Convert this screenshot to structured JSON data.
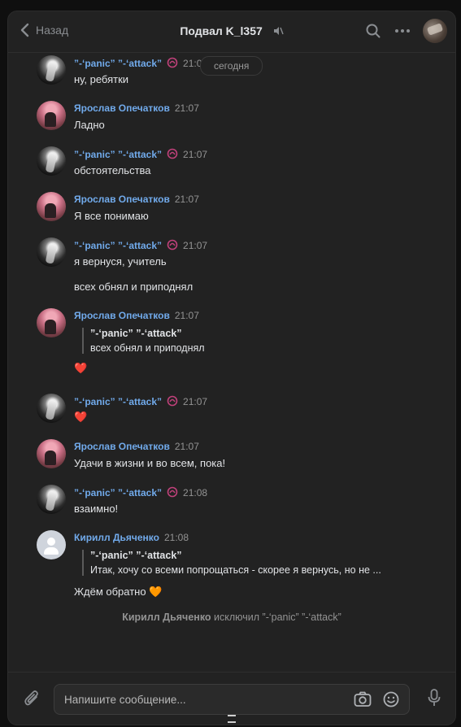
{
  "header": {
    "back_label": "Назад",
    "title": "Подвал K_l357"
  },
  "date_pill": "сегодня",
  "messages": [
    {
      "author": "”-‘panic” ”-‘attack”",
      "time": "21:07",
      "text": "ну, ребятки"
    },
    {
      "author": "Ярослав Опечатков",
      "time": "21:07",
      "text": "Ладно"
    },
    {
      "author": "”-‘panic” ”-‘attack”",
      "time": "21:07",
      "text": "обстоятельства"
    },
    {
      "author": "Ярослав Опечатков",
      "time": "21:07",
      "text": "Я все понимаю"
    },
    {
      "author": "”-‘panic” ”-‘attack”",
      "time": "21:07",
      "text": "я вернуся, учитель",
      "text2": "всех обнял и приподнял"
    },
    {
      "author": "Ярослав Опечатков",
      "time": "21:07",
      "quote_author": "”-‘panic” ”-‘attack”",
      "quote_text": "всех обнял и приподнял",
      "text": "❤️"
    },
    {
      "author": "”-‘panic” ”-‘attack”",
      "time": "21:07",
      "text": "❤️"
    },
    {
      "author": "Ярослав Опечатков",
      "time": "21:07",
      "text": "Удачи в жизни и во всем, пока!"
    },
    {
      "author": "”-‘panic” ”-‘attack”",
      "time": "21:08",
      "text": "взаимно!"
    },
    {
      "author": "Кирилл Дьяченко",
      "time": "21:08",
      "quote_author": "”-‘panic” ”-‘attack”",
      "quote_text": "Итак, хочу со всеми попрощаться - скорее я вернусь, но не ...",
      "text": "Ждём обратно",
      "text_emoji": "🧡"
    }
  ],
  "service_message": {
    "actor": "Кирилл Дьяченко",
    "action": "исключил",
    "target": "”-‘panic” ”-‘attack”"
  },
  "composer": {
    "placeholder": "Напишите сообщение..."
  },
  "colors": {
    "accent_name": "#71aaeb",
    "background": "#222222",
    "heart": "#ff6f2c"
  },
  "icons": [
    "back-chevron-icon",
    "mute-icon",
    "search-icon",
    "more-icon",
    "flame-badge-icon",
    "attach-icon",
    "camera-icon",
    "emoji-icon",
    "mic-icon"
  ]
}
